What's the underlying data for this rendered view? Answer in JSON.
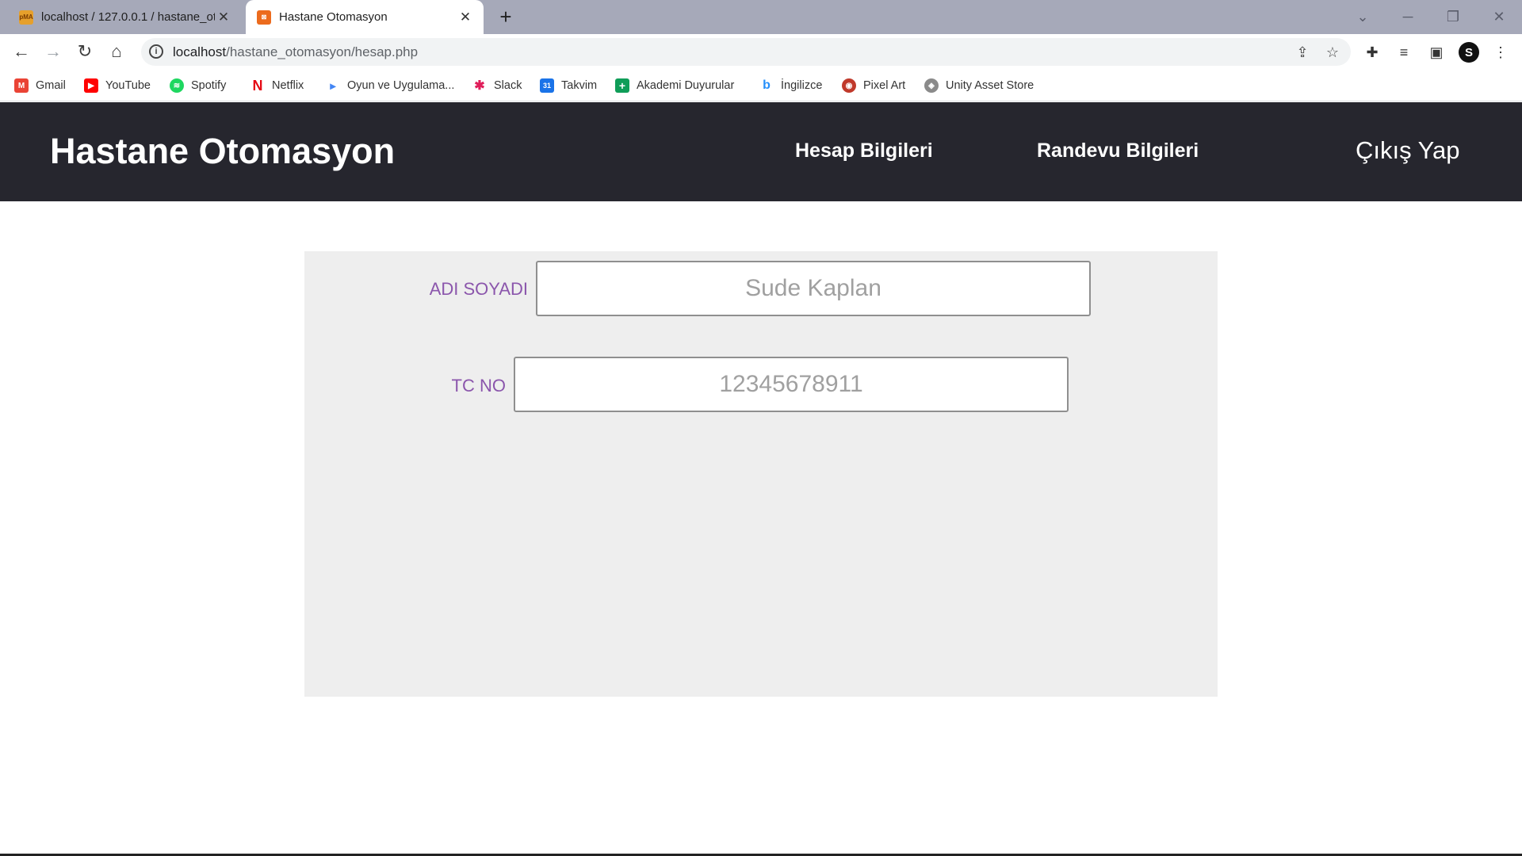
{
  "browser": {
    "tabs": [
      {
        "title": "localhost / 127.0.0.1 / hastane_ot",
        "favicon": "phpmyadmin-icon",
        "active": false
      },
      {
        "title": "Hastane Otomasyon",
        "favicon": "xampp-icon",
        "active": true
      }
    ],
    "new_tab_glyph": "+",
    "tab_close_glyph": "✕",
    "url_host": "localhost",
    "url_path": "/hastane_otomasyon/hesap.php",
    "avatar_letter": "S",
    "bookmarks": [
      {
        "label": "Gmail",
        "icon": "gmail-icon",
        "color": "#ea4335"
      },
      {
        "label": "YouTube",
        "icon": "youtube-icon",
        "color": "#ff0000"
      },
      {
        "label": "Spotify",
        "icon": "spotify-icon",
        "color": "#1ed760"
      },
      {
        "label": "Netflix",
        "icon": "netflix-icon",
        "color": "#e50914"
      },
      {
        "label": "Oyun ve Uygulama...",
        "icon": "google-play-icon",
        "color": "#4285f4"
      },
      {
        "label": "Slack",
        "icon": "slack-icon",
        "color": "#e01e5a"
      },
      {
        "label": "Takvim",
        "icon": "calendar-icon",
        "color": "#1a73e8"
      },
      {
        "label": "Akademi Duyurular",
        "icon": "plus-document-icon",
        "color": "#0f9d58"
      },
      {
        "label": "İngilizce",
        "icon": "bing-icon",
        "color": "#258ffa"
      },
      {
        "label": "Pixel Art",
        "icon": "pixel-art-icon",
        "color": "#c0392b"
      },
      {
        "label": "Unity Asset Store",
        "icon": "unity-icon",
        "color": "#8a8a8a"
      }
    ]
  },
  "site": {
    "title": "Hastane Otomasyon",
    "nav": {
      "account": "Hesap Bilgileri",
      "appointments": "Randevu Bilgileri",
      "logout": "Çıkış Yap"
    },
    "form": {
      "name_label": "ADI SOYADI",
      "name_placeholder": "Sude Kaplan",
      "tc_label": "TC NO",
      "tc_placeholder": "12345678911"
    }
  },
  "colors": {
    "header_bg": "#26262e",
    "label_color": "#8b56ac",
    "panel_bg": "#eeeeee"
  }
}
